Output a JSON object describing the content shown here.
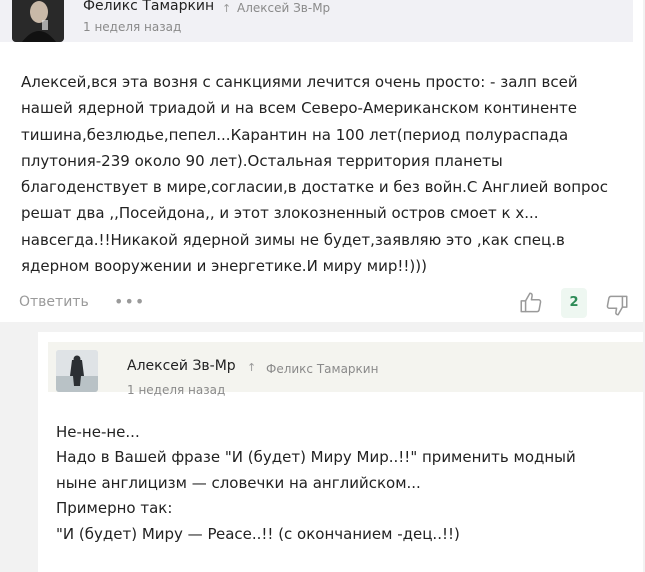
{
  "comments": [
    {
      "author": "Феликс Тамаркин",
      "reply_to": "Алексей Зв-Мр",
      "time": "1 неделя назад",
      "lines": [
        "Алексей,вся эта возня с санкциями лечится очень просто: - залп всей",
        "нашей ядерной триадой и на всем Северо-Американском континенте",
        "тишина,безлюдье,пепел...Карантин на 100 лет(период полураспада",
        "плутония-239 около 90 лет).Остальная территория планеты",
        "благоденствует в мире,согласии,в достатке и без войн.С Англией вопрос",
        "решат два ,,Посейдона,, и этот злокозненный остров смоет к х...",
        "навсегда.!!Никакой ядерной зимы не будет,заявляю это ,как спец.в",
        "ядерном вооружении и энергетике.И миру мир!!)))"
      ],
      "reply_label": "Ответить",
      "more_label": "•••",
      "like_count": "2"
    },
    {
      "author": "Алексей Зв-Мр",
      "reply_to": "Феликс Тамаркин",
      "time": "1 неделя назад",
      "lines": [
        "Не-не-не...",
        "Надо в Вашей фразе \"И (будет) Миру Мир..!!\" применить модный",
        "ныне англицизм — словечки на английском...",
        "Примерно так:",
        "\"И (будет) Миру — Peace..!! (с окончанием -дец..!!)"
      ]
    }
  ],
  "colors": {
    "header_bg_1": "#f1f1f5",
    "header_bg_2": "#f4f4ef",
    "like_count_bg": "#eef7f1",
    "like_count_text": "#2e8b57",
    "muted_text": "#8a8a8a"
  },
  "icons": {
    "arrow": "↑",
    "like": "thumbs-up-icon",
    "dislike": "thumbs-down-icon"
  }
}
